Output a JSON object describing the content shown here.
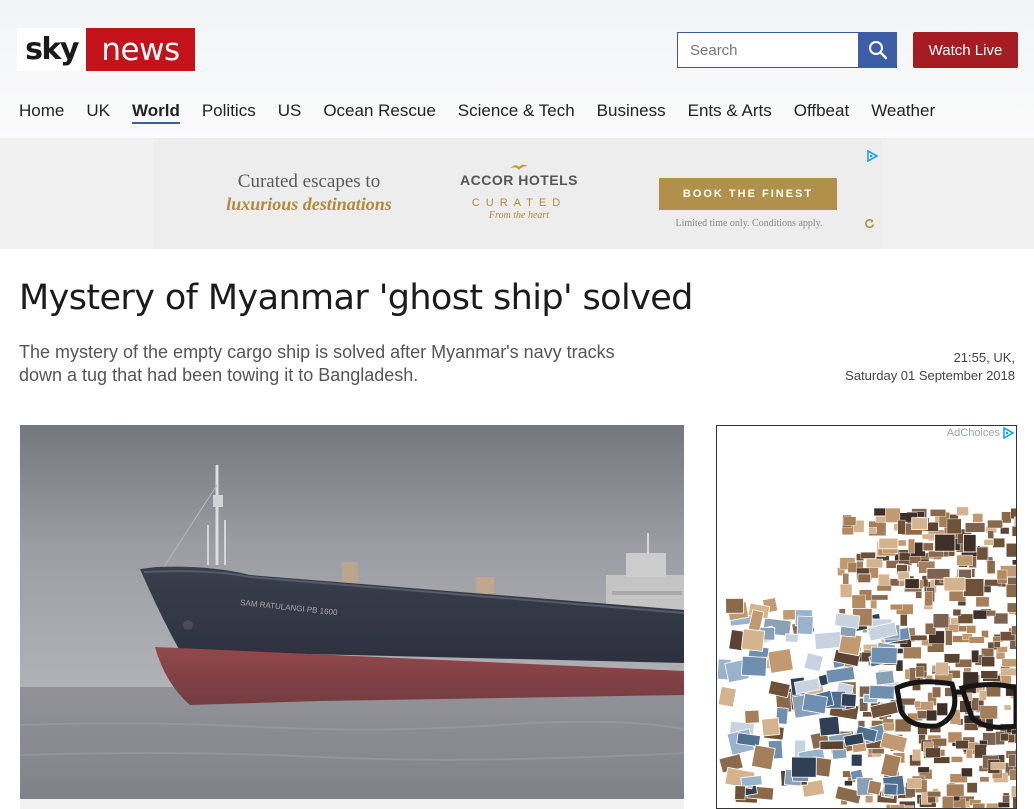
{
  "header": {
    "logo_sky": "sky",
    "logo_news": "news",
    "search_placeholder": "Search",
    "watch_live": "Watch Live"
  },
  "nav": {
    "items": [
      "Home",
      "UK",
      "World",
      "Politics",
      "US",
      "Ocean Rescue",
      "Science & Tech",
      "Business",
      "Ents & Arts",
      "Offbeat",
      "Weather"
    ],
    "active": "World"
  },
  "top_ad": {
    "line1": "Curated escapes to",
    "line2": "luxurious destinations",
    "brand": "ACCOR HOTELS",
    "curated": "CURATED",
    "from_the_heart": "From the heart",
    "cta": "BOOK THE FINEST",
    "disclaimer": "Limited time only. Conditions apply."
  },
  "article": {
    "headline": "Mystery of Myanmar 'ghost ship' solved",
    "standfirst": "The mystery of the empty cargo ship is solved after Myanmar's navy tracks down a tug that had been towing it to Bangladesh.",
    "time": "21:55, UK,",
    "date": "Saturday 01 September 2018"
  },
  "side_ad": {
    "adchoices": "AdChoices"
  },
  "colors": {
    "brand_red": "#c4121a",
    "watch_live": "#a51c23",
    "search_blue": "#3d5ea6",
    "ad_gold": "#b0904a"
  }
}
